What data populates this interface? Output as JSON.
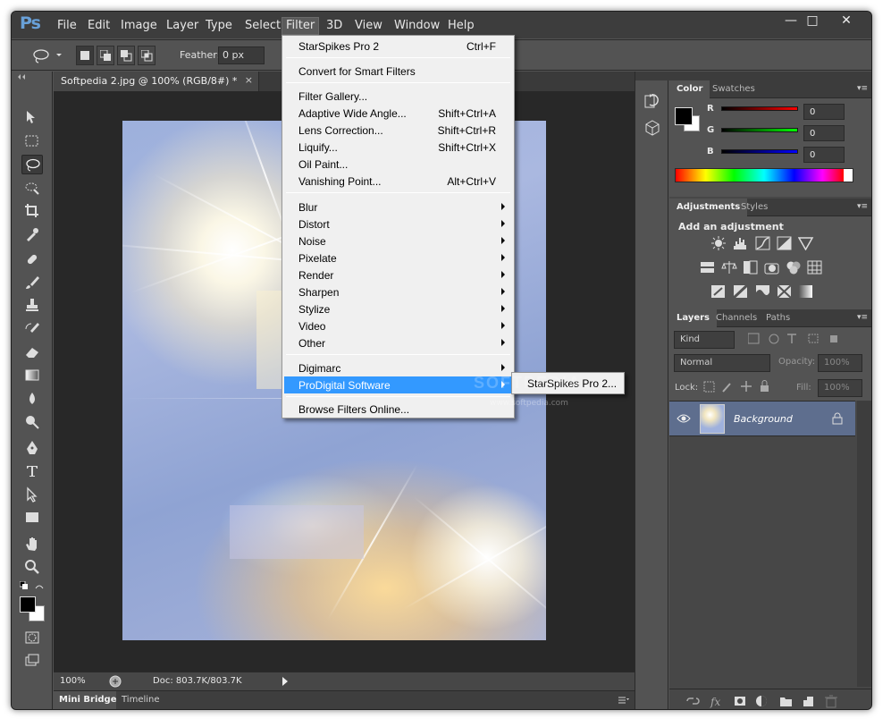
{
  "app": {
    "logo": "Ps"
  },
  "menubar": {
    "items": [
      "File",
      "Edit",
      "Image",
      "Layer",
      "Type",
      "Select",
      "Filter",
      "3D",
      "View",
      "Window",
      "Help"
    ],
    "window_controls": {
      "minimize": "—",
      "maximize": "□",
      "close": "✕"
    }
  },
  "options": {
    "feather_label": "Feather:",
    "feather_value": "0 px"
  },
  "document": {
    "tab_title": "Softpedia 2.jpg @ 100% (RGB/8#) *",
    "tab_close": "×",
    "watermark": "SOFTPEDIA",
    "watermark_url": "www.softpedia.com"
  },
  "status": {
    "zoom": "100%",
    "doc_size": "Doc: 803.7K/803.7K"
  },
  "bottom_tabs": {
    "mini_bridge": "Mini Bridge",
    "timeline": "Timeline"
  },
  "filter_menu": {
    "top": {
      "label": "StarSpikes Pro 2",
      "shortcut": "Ctrl+F"
    },
    "convert": "Convert for Smart Filters",
    "gallery": [
      {
        "label": "Filter Gallery...",
        "shortcut": ""
      },
      {
        "label": "Adaptive Wide Angle...",
        "shortcut": "Shift+Ctrl+A"
      },
      {
        "label": "Lens Correction...",
        "shortcut": "Shift+Ctrl+R"
      },
      {
        "label": "Liquify...",
        "shortcut": "Shift+Ctrl+X"
      },
      {
        "label": "Oil Paint...",
        "shortcut": ""
      },
      {
        "label": "Vanishing Point...",
        "shortcut": "Alt+Ctrl+V"
      }
    ],
    "groups": [
      "Blur",
      "Distort",
      "Noise",
      "Pixelate",
      "Render",
      "Sharpen",
      "Stylize",
      "Video",
      "Other"
    ],
    "plugins": [
      "Digimarc",
      "ProDigital Software"
    ],
    "browse": "Browse Filters Online..."
  },
  "submenu": {
    "item": "StarSpikes Pro 2..."
  },
  "color_panel": {
    "tabs": [
      "Color",
      "Swatches"
    ],
    "r_label": "R",
    "g_label": "G",
    "b_label": "B",
    "r": "0",
    "g": "0",
    "b": "0"
  },
  "adjustments_panel": {
    "tabs": [
      "Adjustments",
      "Styles"
    ],
    "heading": "Add an adjustment"
  },
  "layers_panel": {
    "tabs": [
      "Layers",
      "Channels",
      "Paths"
    ],
    "kind": "Kind",
    "blend_mode": "Normal",
    "opacity_label": "Opacity:",
    "opacity": "100%",
    "lock_label": "Lock:",
    "fill_label": "Fill:",
    "fill": "100%",
    "layer_name": "Background"
  },
  "colors": {
    "highlight": "#3399ff",
    "chrome": "#535353",
    "menubar": "#3d3d3d"
  }
}
